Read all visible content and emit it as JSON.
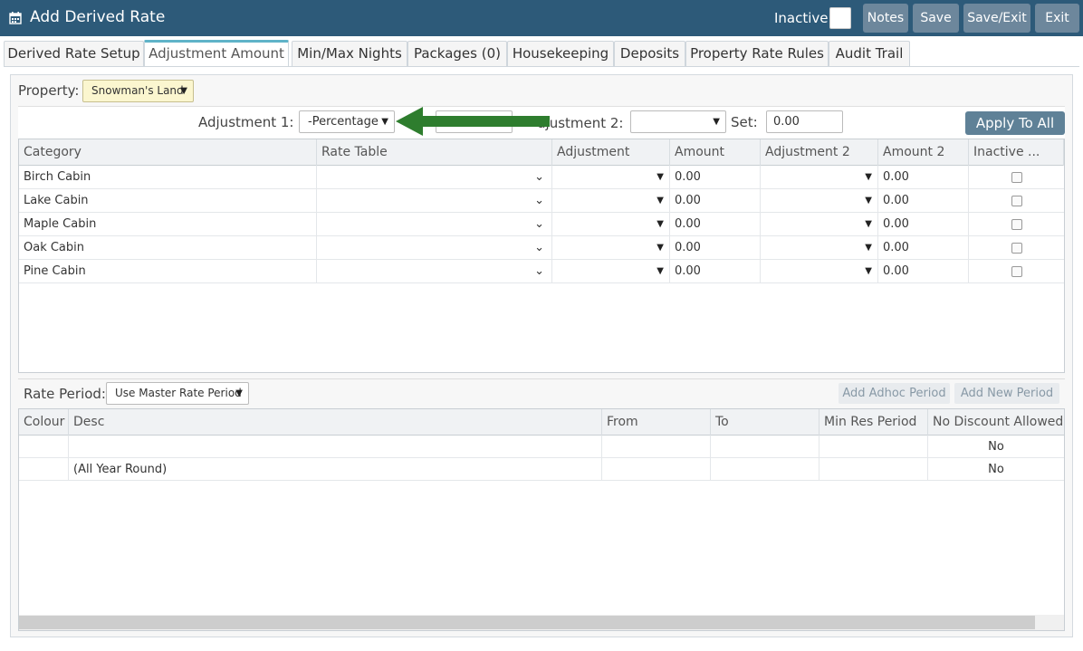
{
  "window": {
    "title": "Add Derived Rate",
    "inactive_label": "Inactive",
    "buttons": {
      "notes": "Notes",
      "save": "Save",
      "save_exit": "Save/Exit",
      "exit": "Exit"
    }
  },
  "tabs": [
    {
      "label": "Derived Rate Setup"
    },
    {
      "label": "Adjustment Amount",
      "active": true
    },
    {
      "label": "Min/Max Nights"
    },
    {
      "label": "Packages (0)"
    },
    {
      "label": "Housekeeping"
    },
    {
      "label": "Deposits"
    },
    {
      "label": "Property Rate Rules"
    },
    {
      "label": "Audit Trail"
    }
  ],
  "property": {
    "label": "Property:",
    "value": "Snowman's Land"
  },
  "adjustment_bar": {
    "adj1_label": "Adjustment 1:",
    "adj1_value": "-Percentage",
    "adj2_label": "djustment 2:",
    "adj2_value": "",
    "set_label": "Set:",
    "set_value": "0.00",
    "apply_label": "Apply To All"
  },
  "category_grid": {
    "headers": [
      "Category",
      "Rate Table",
      "Adjustment",
      "Amount",
      "Adjustment 2",
      "Amount 2",
      "Inactive ..."
    ],
    "rows": [
      {
        "category": "Birch Cabin",
        "amount": "0.00",
        "amount2": "0.00"
      },
      {
        "category": "Lake Cabin",
        "amount": "0.00",
        "amount2": "0.00"
      },
      {
        "category": "Maple Cabin",
        "amount": "0.00",
        "amount2": "0.00"
      },
      {
        "category": "Oak Cabin",
        "amount": "0.00",
        "amount2": "0.00"
      },
      {
        "category": "Pine Cabin",
        "amount": "0.00",
        "amount2": "0.00"
      }
    ]
  },
  "rate_period": {
    "label": "Rate Period:",
    "value": "Use Master Rate Period",
    "add_adhoc": "Add Adhoc Period",
    "add_new": "Add New Period"
  },
  "period_grid": {
    "headers": [
      "Colour",
      "Desc",
      "From",
      "To",
      "Min Res Period",
      "No Discount Allowed"
    ],
    "rows": [
      {
        "desc": "",
        "no_discount": "No"
      },
      {
        "desc": "(All Year Round)",
        "no_discount": "No"
      }
    ]
  },
  "colors": {
    "titlebar": "#2d5a79",
    "button": "#6d879c",
    "accent_tab": "#5fb3c8",
    "arrow": "#2e7d2e"
  }
}
